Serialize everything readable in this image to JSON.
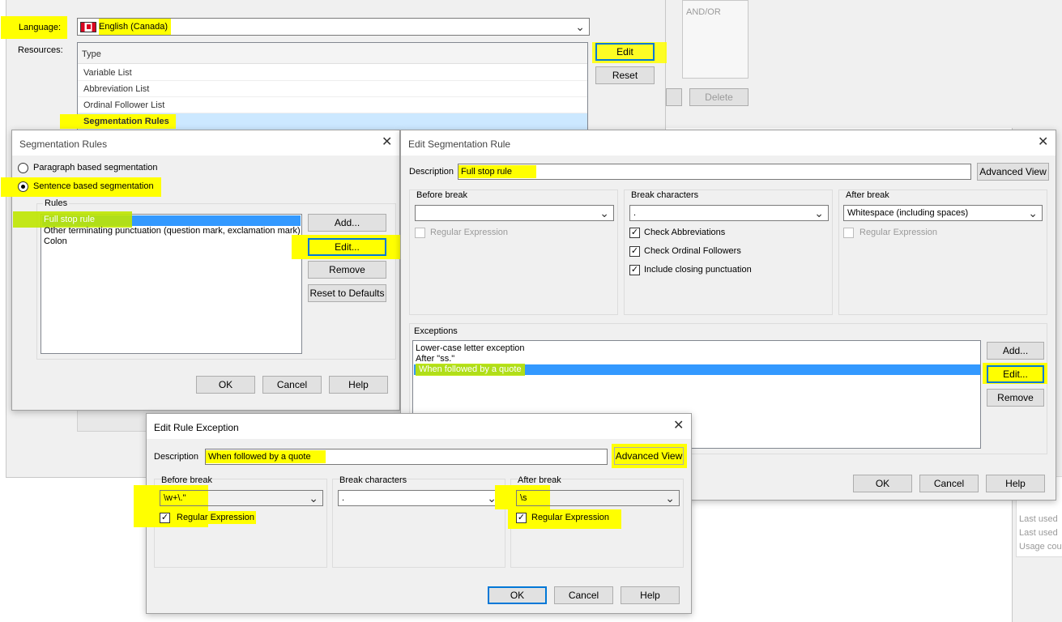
{
  "language_dialog": {
    "language_label": "Language:",
    "language_value": "English (Canada)",
    "resources_label": "Resources:",
    "column_header": "Type",
    "resources": [
      "Variable List",
      "Abbreviation List",
      "Ordinal Follower List",
      "Segmentation Rules"
    ],
    "edit_button": "Edit",
    "reset_button": "Reset"
  },
  "background_dialog": {
    "and_or_header": "AND/OR",
    "delete_button": "Delete",
    "side_list": [
      "Last used",
      "Last used",
      "Usage cou"
    ]
  },
  "segmentation_rules": {
    "title": "Segmentation Rules",
    "paragraph_option": "Paragraph based segmentation",
    "sentence_option": "Sentence based segmentation",
    "rules_label": "Rules",
    "rules": [
      "Full stop rule",
      "Other terminating punctuation (question mark, exclamation mark)",
      "Colon"
    ],
    "add_button": "Add...",
    "edit_button": "Edit...",
    "remove_button": "Remove",
    "reset_defaults_button": "Reset to Defaults",
    "ok_button": "OK",
    "cancel_button": "Cancel",
    "help_button": "Help"
  },
  "edit_segmentation_rule": {
    "title": "Edit Segmentation Rule",
    "description_label": "Description",
    "description_value": "Full stop rule",
    "advanced_view_button": "Advanced View",
    "before_break_label": "Before break",
    "before_break_value": "",
    "before_regex_label": "Regular Expression",
    "break_chars_label": "Break characters",
    "break_chars_value": ".",
    "check_abbreviations": "Check Abbreviations",
    "check_ordinal": "Check Ordinal Followers",
    "include_closing": "Include closing punctuation",
    "after_break_label": "After break",
    "after_break_value": "Whitespace (including spaces)",
    "after_regex_label": "Regular Expression",
    "exceptions_label": "Exceptions",
    "exceptions": [
      "Lower-case letter exception",
      "After \"ss.\"",
      "When followed by a quote"
    ],
    "add_button": "Add...",
    "edit_button": "Edit...",
    "remove_button": "Remove",
    "ok_button": "OK",
    "cancel_button": "Cancel",
    "help_button": "Help"
  },
  "edit_rule_exception": {
    "title": "Edit Rule Exception",
    "description_label": "Description",
    "description_value": "When followed by a quote",
    "advanced_view_button": "Advanced View",
    "before_break_label": "Before break",
    "before_break_value": "\\w+\\.\"",
    "before_regex_label": "Regular Expression",
    "break_chars_label": "Break characters",
    "break_chars_value": ".",
    "after_break_label": "After break",
    "after_break_value": "\\s",
    "after_regex_label": "Regular Expression",
    "ok_button": "OK",
    "cancel_button": "Cancel",
    "help_button": "Help"
  }
}
